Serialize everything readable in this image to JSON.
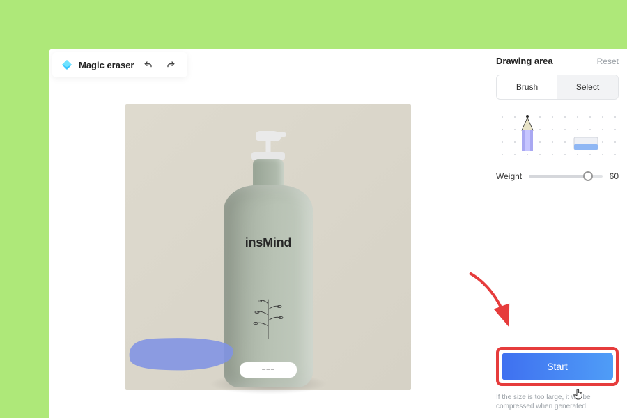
{
  "toolbar": {
    "title": "Magic eraser"
  },
  "canvas": {
    "product_brand": "insMind"
  },
  "panel": {
    "title": "Drawing area",
    "reset_label": "Reset",
    "tabs": {
      "brush": "Brush",
      "select": "Select"
    },
    "weight_label": "Weight",
    "weight_value": "60",
    "slider_pct": 80,
    "start_label": "Start",
    "hint": "If the size is too large, it will be compressed when generated."
  }
}
